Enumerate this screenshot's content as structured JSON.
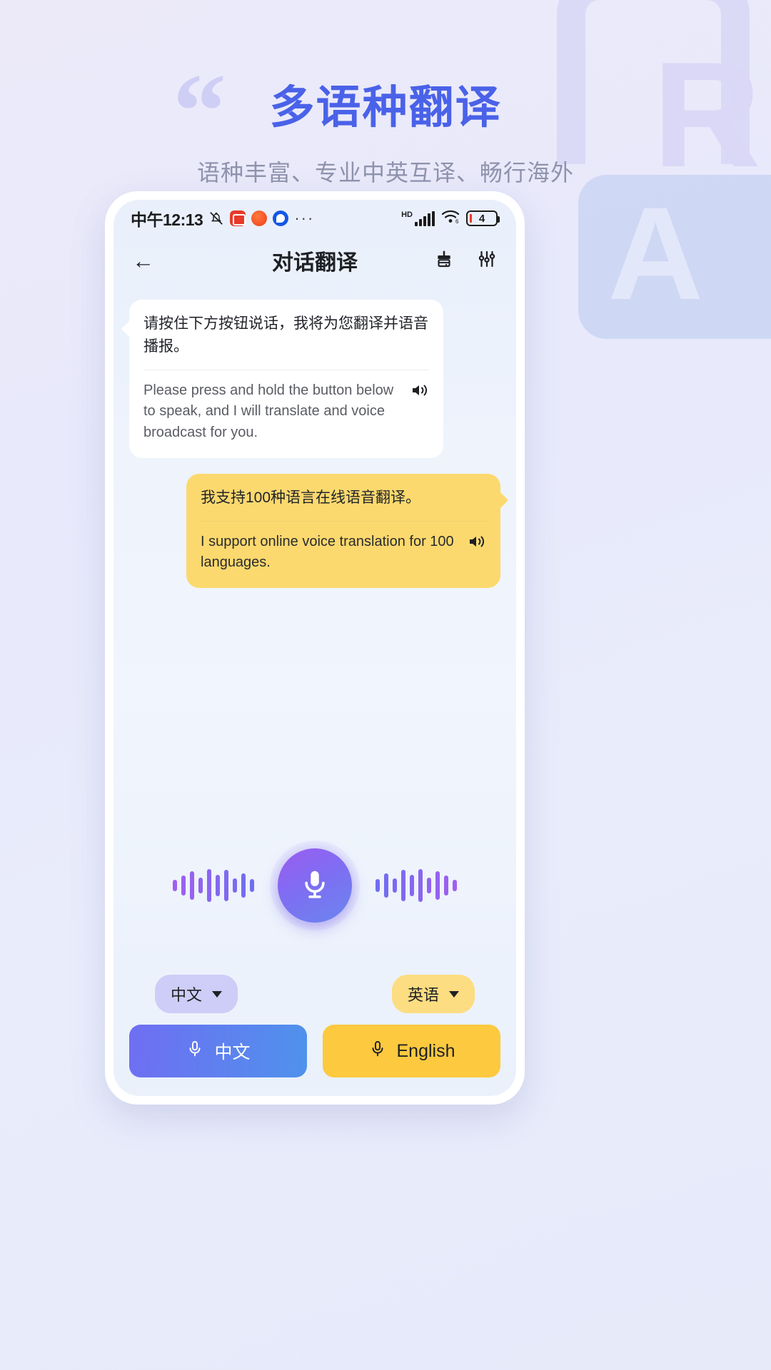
{
  "hero": {
    "quote_mark": "“",
    "title": "多语种翻译",
    "subtitle": "语种丰富、专业中英互译、畅行海外",
    "deco_letter_r": "R",
    "deco_letter_a": "A",
    "accent_color": "#4a62e8",
    "subtitle_color": "#8f93ad"
  },
  "statusbar": {
    "time": "中午12:13",
    "mute_icon": "bell-muted-icon",
    "app_icons": [
      "app-icon-red",
      "app-icon-orange",
      "app-icon-blue"
    ],
    "overflow": "···",
    "hd_label": "HD",
    "signal_icon": "signal-bars-icon",
    "wifi_icon": "wifi-icon",
    "wifi_generation": "6",
    "battery_level": "4"
  },
  "header": {
    "back_icon": "back-arrow-icon",
    "title": "对话翻译",
    "clear_icon": "brush-clear-icon",
    "settings_icon": "sliders-settings-icon"
  },
  "chat": {
    "messages": [
      {
        "side": "left",
        "style": "white",
        "source": "请按住下方按钮说话，我将为您翻译并语音播报。",
        "translation": "Please press and hold the button below to speak, and I will translate and voice broadcast for you.",
        "speaker_icon": "speaker-icon"
      },
      {
        "side": "right",
        "style": "yellow",
        "source": "我支持100种语言在线语音翻译。",
        "translation": "I support online voice translation for 100 languages.",
        "speaker_icon": "speaker-icon"
      }
    ]
  },
  "mic": {
    "button_icon": "microphone-icon",
    "left_wave_heights": [
      16,
      28,
      40,
      22,
      46,
      30,
      44,
      20,
      34,
      18
    ],
    "right_wave_heights": [
      18,
      34,
      20,
      44,
      30,
      46,
      22,
      40,
      28,
      16
    ],
    "wave_color_start": "#6f6ef2",
    "wave_color_end": "#a15ef0",
    "button_gradient": [
      "#9b5cf0",
      "#6a86ef"
    ]
  },
  "bottom": {
    "source_lang": {
      "label": "中文",
      "caret_icon": "chevron-down-icon",
      "color": "#cdcdf7"
    },
    "target_lang": {
      "label": "英语",
      "caret_icon": "chevron-down-icon",
      "color": "#fcdd81"
    },
    "left_button": {
      "label": "中文",
      "mic_icon": "microphone-icon",
      "color": "#6f6ef2"
    },
    "right_button": {
      "label": "English",
      "mic_icon": "microphone-icon",
      "color": "#fcc93f"
    }
  }
}
